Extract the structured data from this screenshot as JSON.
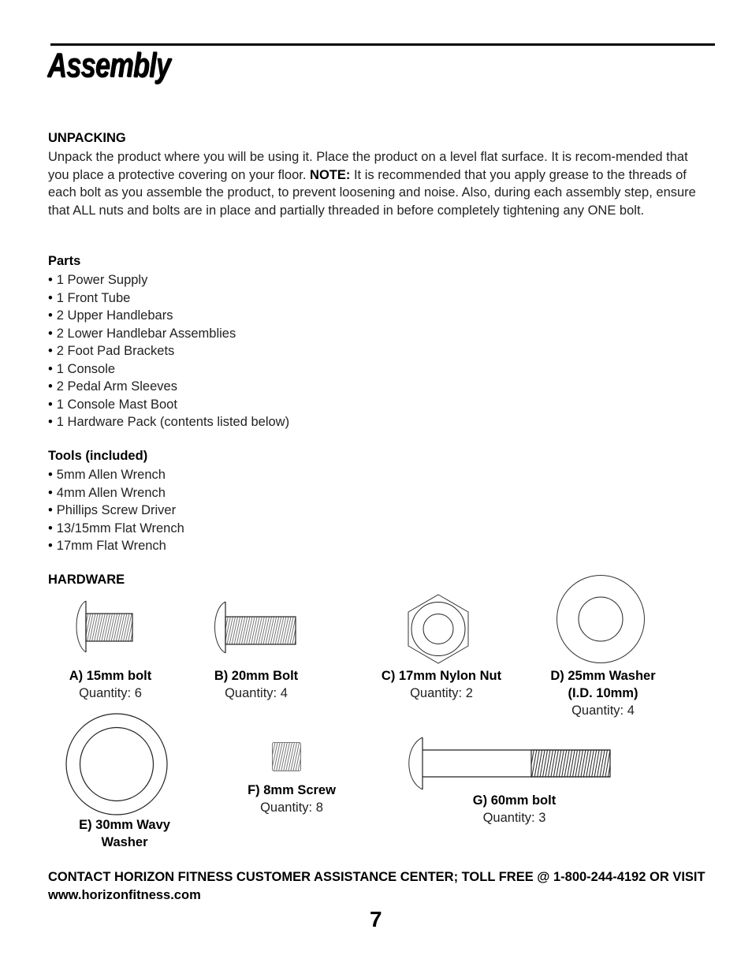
{
  "page": {
    "title": "Assembly",
    "page_number": "7"
  },
  "unpacking": {
    "heading": "UNPACKING",
    "text_before_note": "Unpack the product where you will be using it. Place the product on a level flat surface. It is recom-mended that you place a protective covering on your floor. ",
    "note_label": "NOTE:",
    "text_after_note": " It is recommended that you apply grease to the threads of each bolt as you assemble the product, to prevent loosening and noise. Also, during each assembly step, ensure that ALL nuts and bolts are in place and partially threaded in before completely tightening any ONE bolt."
  },
  "parts": {
    "heading": "Parts",
    "items": [
      "1 Power Supply",
      "1 Front Tube",
      "2 Upper Handlebars",
      "2 Lower Handlebar Assemblies",
      "2 Foot Pad Brackets",
      "1 Console",
      "2 Pedal Arm Sleeves",
      "1 Console Mast Boot",
      "1 Hardware Pack (contents listed below)"
    ]
  },
  "tools": {
    "heading": "Tools (included)",
    "items": [
      "5mm Allen Wrench",
      "4mm Allen Wrench",
      "Phillips Screw Driver",
      "13/15mm Flat Wrench",
      "17mm Flat Wrench"
    ]
  },
  "hardware": {
    "heading": "HARDWARE",
    "items": [
      {
        "name": "A) 15mm bolt",
        "quantity": "Quantity: 6",
        "icon": "bolt-icon"
      },
      {
        "name": "B) 20mm Bolt",
        "quantity": "Quantity: 4",
        "icon": "bolt-icon"
      },
      {
        "name": "C) 17mm Nylon Nut",
        "quantity": "Quantity: 2",
        "icon": "hex-nut-icon"
      },
      {
        "name_line1": "D) 25mm Washer",
        "name_line2": "(I.D. 10mm)",
        "quantity": "Quantity: 4",
        "icon": "washer-icon"
      },
      {
        "name_line1": "E) 30mm Wavy",
        "name_line2": "Washer",
        "icon": "wavy-washer-icon"
      },
      {
        "name": "F) 8mm Screw",
        "quantity": "Quantity: 8",
        "icon": "set-screw-icon"
      },
      {
        "name": "G) 60mm bolt",
        "quantity": "Quantity: 3",
        "icon": "long-bolt-icon"
      }
    ]
  },
  "footer": {
    "contact": "CONTACT HORIZON FITNESS CUSTOMER ASSISTANCE CENTER; TOLL FREE @ 1-800-244-4192 OR VISIT www.horizonfitness.com"
  }
}
